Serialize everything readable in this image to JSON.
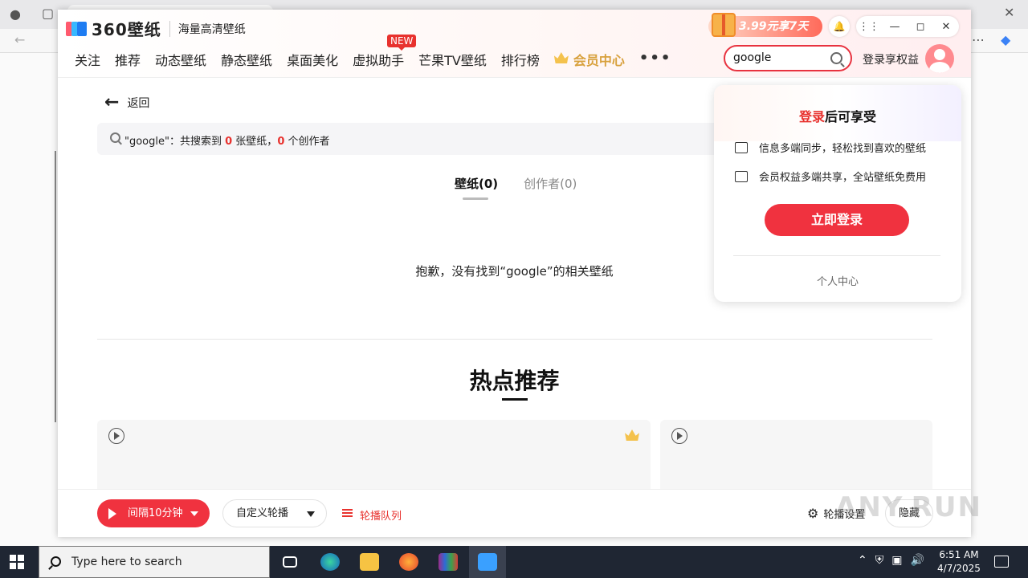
{
  "app": {
    "logo_text": "360壁纸",
    "slogan": "海量高清壁纸",
    "promo": "3.99元享7天"
  },
  "nav": {
    "items": [
      "关注",
      "推荐",
      "动态壁纸",
      "静态壁纸",
      "桌面美化",
      "虚拟助手",
      "芒果TV壁纸",
      "排行榜"
    ],
    "vip": "会员中心",
    "more": "•••",
    "new_badge": "NEW"
  },
  "search": {
    "value": "google"
  },
  "header": {
    "login_link": "登录享权益"
  },
  "content": {
    "back_label": "返回",
    "result": {
      "prefix": "\"google\"：共搜索到 ",
      "wallpaper_count": "0",
      "mid": " 张壁纸，",
      "creator_count": "0",
      "suffix": " 个创作者"
    },
    "tabs": [
      {
        "label": "壁纸(0)",
        "active": true
      },
      {
        "label": "创作者(0)",
        "active": false
      }
    ],
    "empty_message": "抱歉，没有找到“google”的相关壁纸",
    "hot_title": "热点推荐"
  },
  "bottom_bar": {
    "interval": "间隔10分钟",
    "custom": "自定义轮播",
    "queue": "轮播队列",
    "settings": "轮播设置",
    "hide": "隐藏"
  },
  "popup": {
    "title_highlight": "登录",
    "title_rest": "后可享受",
    "benefits": [
      "信息多端同步，轻松找到喜欢的壁纸",
      "会员权益多端共享，全站壁纸免费用"
    ],
    "login_button": "立即登录",
    "personal_center": "个人中心"
  },
  "taskbar": {
    "search_placeholder": "Type here to search",
    "time": "6:51 AM",
    "date": "4/7/2025"
  },
  "watermark": "ANY.RUN",
  "colors": {
    "accent": "#f0323f",
    "vip_gold": "#d8a13d"
  }
}
